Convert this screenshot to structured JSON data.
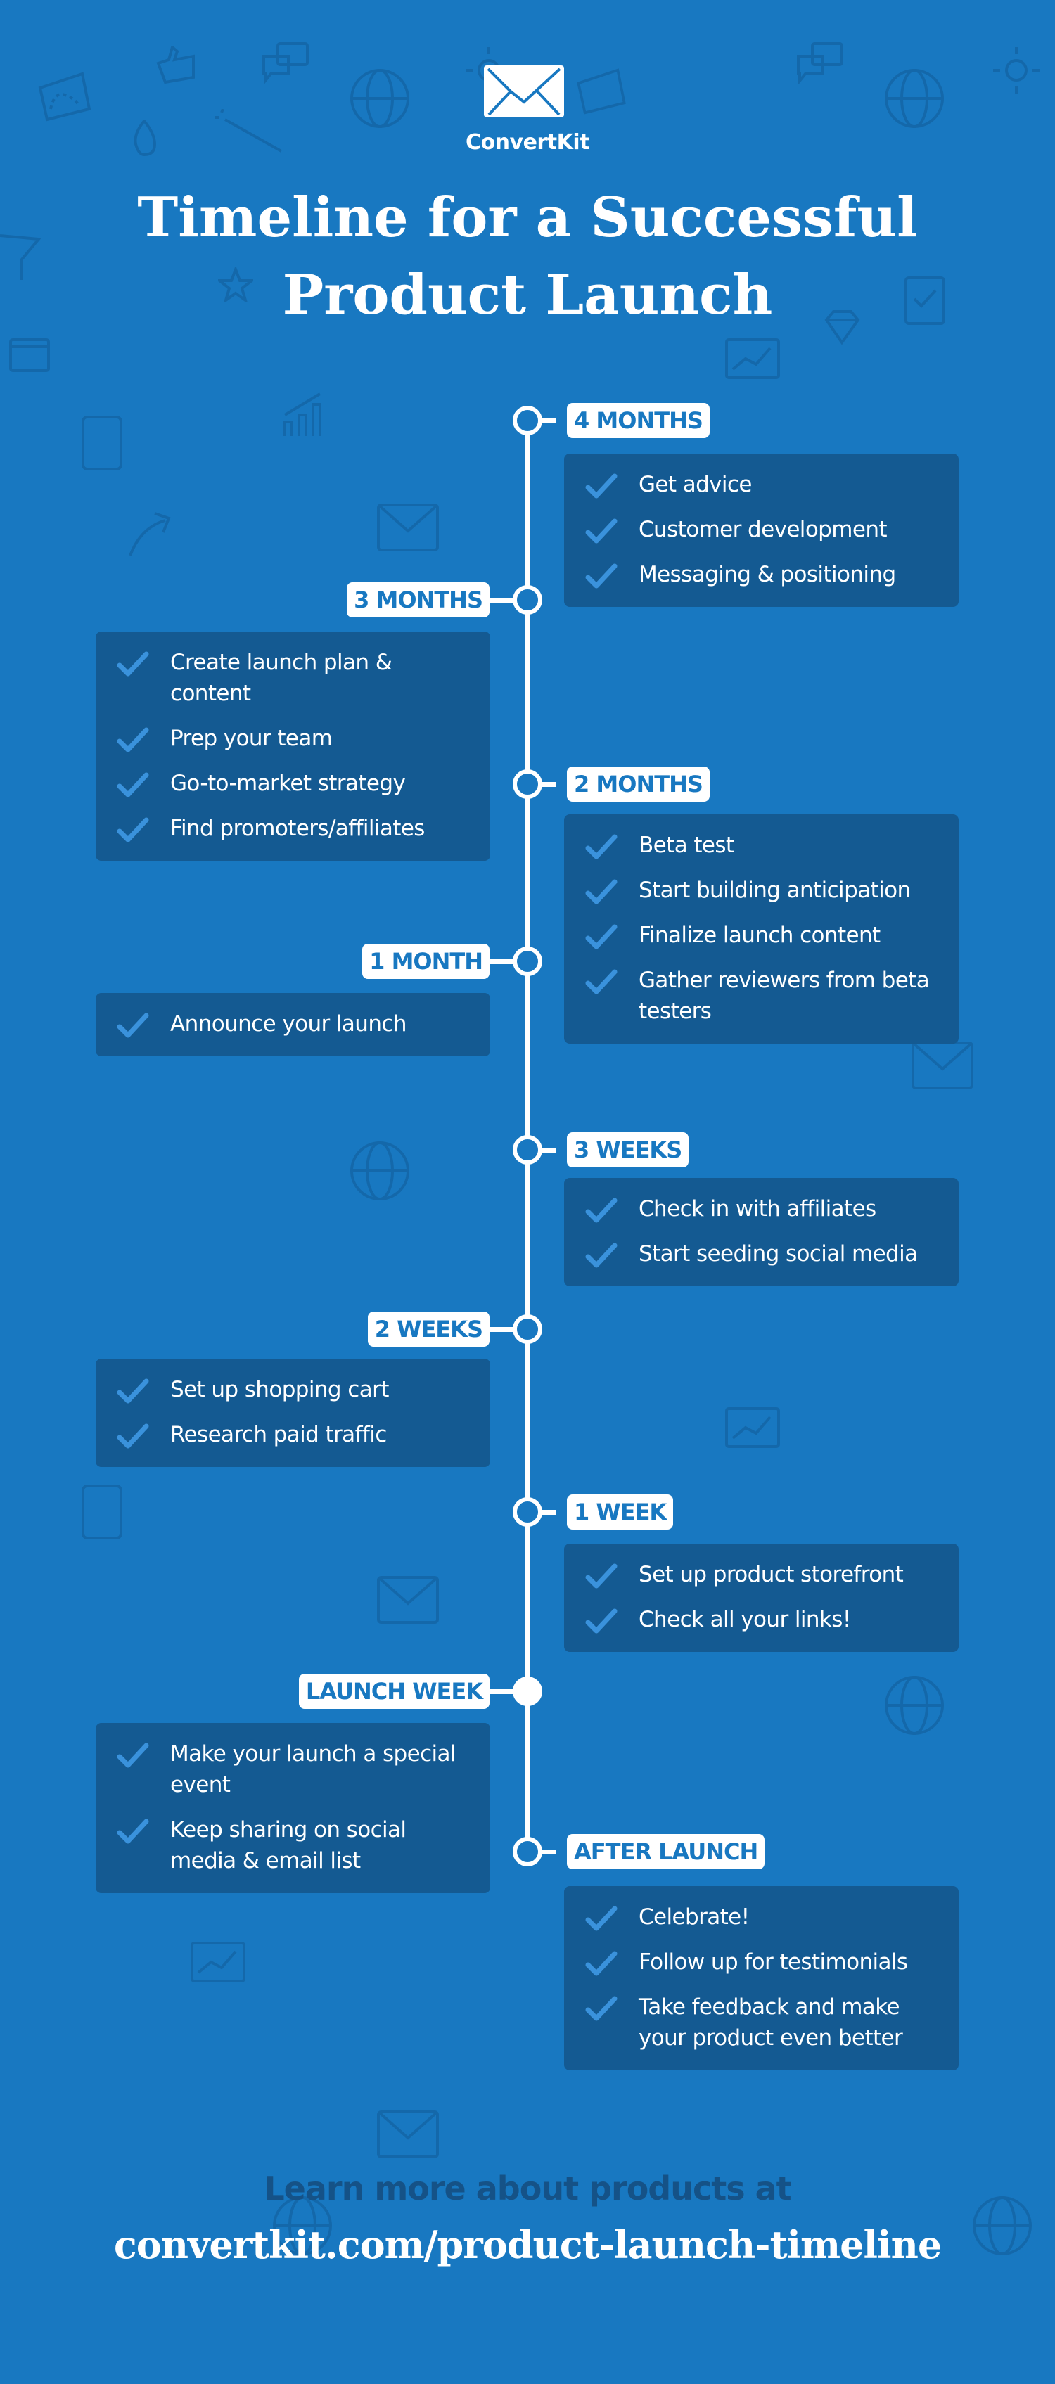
{
  "brand": {
    "name": "ConvertKit",
    "logo_icon": "envelope-icon"
  },
  "header": {
    "title_line1": "Timeline for a Successful",
    "title_line2": "Product Launch"
  },
  "colors": {
    "background": "#1878c1",
    "card": "#145a92",
    "check": "#3a92dc",
    "tag_text": "#1878c1",
    "footer_text_dark": "#155287"
  },
  "timeline": [
    {
      "label": "4 MONTHS",
      "side": "right",
      "node": "hollow",
      "items": [
        "Get advice",
        "Customer development",
        "Messaging & positioning"
      ]
    },
    {
      "label": "3 MONTHS",
      "side": "left",
      "node": "hollow",
      "items": [
        "Create launch plan & content",
        "Prep your team",
        "Go-to-market strategy",
        "Find promoters/affiliates"
      ]
    },
    {
      "label": "2 MONTHS",
      "side": "right",
      "node": "hollow",
      "items": [
        "Beta test",
        "Start building anticipation",
        "Finalize launch content",
        "Gather reviewers from beta testers"
      ]
    },
    {
      "label": "1 MONTH",
      "side": "left",
      "node": "hollow",
      "items": [
        "Announce your launch"
      ]
    },
    {
      "label": "3 WEEKS",
      "side": "right",
      "node": "hollow",
      "items": [
        "Check in with affiliates",
        "Start seeding social media"
      ]
    },
    {
      "label": "2 WEEKS",
      "side": "left",
      "node": "hollow",
      "items": [
        "Set up shopping cart",
        "Research paid traffic"
      ]
    },
    {
      "label": "1 WEEK",
      "side": "right",
      "node": "hollow",
      "items": [
        "Set up product storefront",
        "Check all your links!"
      ]
    },
    {
      "label": "LAUNCH WEEK",
      "side": "left",
      "node": "filled",
      "items": [
        "Make your launch a special event",
        "Keep sharing on social media & email list"
      ]
    },
    {
      "label": "AFTER LAUNCH",
      "side": "right",
      "node": "hollow",
      "items": [
        "Celebrate!",
        "Follow up for testimonials",
        "Take feedback and make your product even better"
      ]
    }
  ],
  "footer": {
    "line1": "Learn more about products at",
    "line2": "convertkit.com/product-launch-timeline"
  }
}
